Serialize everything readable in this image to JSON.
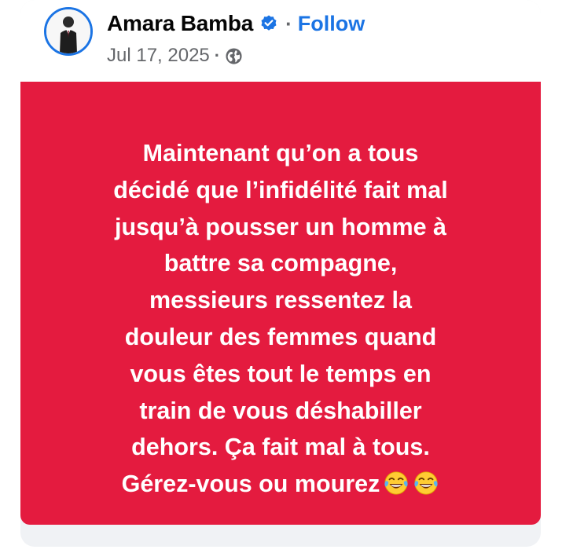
{
  "post": {
    "author": {
      "name": "Amara Bamba",
      "verified_icon": "verified-badge-icon",
      "follow_label": "Follow",
      "separator": "·"
    },
    "meta": {
      "date": "Jul 17, 2025",
      "separator": "·",
      "audience_icon": "globe-icon"
    },
    "background_color": "#e41b3f",
    "text_lines": [
      "Maintenant qu’on a tous",
      "décidé que l’infidélité fait mal",
      "jusqu’à pousser un homme à",
      "battre sa compagne,",
      "messieurs ressentez la",
      "douleur des femmes quand",
      "vous êtes tout le temps en",
      "train de vous déshabiller",
      "dehors. Ça fait mal à tous.",
      "Gérez-vous ou mourez"
    ],
    "trailing_emojis": [
      "face-with-tears-of-joy-icon",
      "face-with-tears-of-joy-icon"
    ]
  },
  "colors": {
    "accent": "#1b74e4",
    "muted_text": "#65676b",
    "body_text": "#ffffff"
  }
}
